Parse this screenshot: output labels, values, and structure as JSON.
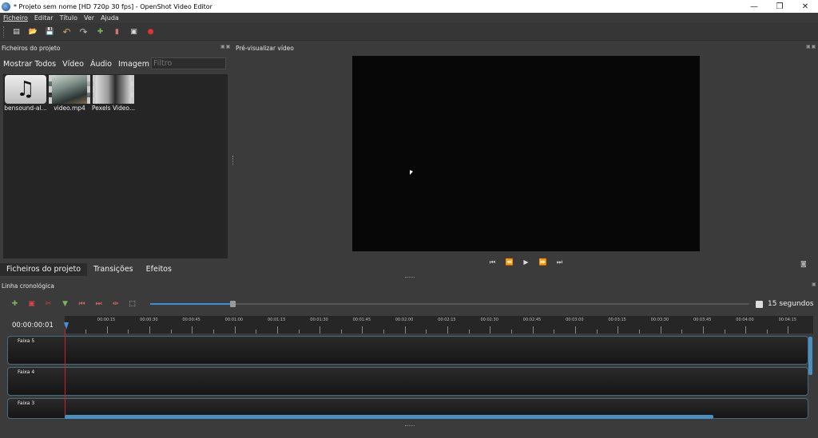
{
  "window": {
    "title": "* Projeto sem nome [HD 720p 30 fps] - OpenShot Video Editor",
    "minimize": "—",
    "maximize": "❐",
    "close": "✕"
  },
  "menu": [
    "Ficheiro",
    "Editar",
    "Título",
    "Ver",
    "Ajuda"
  ],
  "toolbar": {
    "icons": [
      "new-file-icon",
      "open-file-icon",
      "save-icon",
      "undo-icon",
      "redo-icon",
      "import-icon",
      "profile-icon",
      "fullscreen-icon",
      "record-icon"
    ],
    "glyphs": [
      "▤",
      "📂",
      "💾",
      "↶",
      "↷",
      "✚",
      "▮",
      "▣",
      "●"
    ]
  },
  "files_panel": {
    "header": "Ficheiros do projeto",
    "tabs": [
      "Mostrar Todos",
      "Vídeo",
      "Áudio",
      "Imagem"
    ],
    "filter_placeholder": "Filtro",
    "items": [
      {
        "label": "bensound-al...",
        "type": "audio"
      },
      {
        "label": "video.mp4",
        "type": "video"
      },
      {
        "label": "Pexels Video...",
        "type": "video"
      }
    ],
    "bottom_tabs": [
      "Ficheiros do projeto",
      "Transições",
      "Efeitos"
    ]
  },
  "preview_panel": {
    "header": "Pré-visualizar vídeo",
    "controls": [
      "⏮",
      "⏪",
      "▶",
      "⏩",
      "⏭"
    ]
  },
  "timeline": {
    "header": "Linha cronológica",
    "toolbar_glyphs": [
      "✚",
      "▣",
      "✂",
      "▼",
      "⏮",
      "⏭",
      "⇹",
      "⬚"
    ],
    "zoom_label": "15 segundos",
    "zoom_fraction": 0.15,
    "time_readout": "00:00:00:01",
    "ruler_labels": [
      "00:00:15",
      "00:00:30",
      "00:00:45",
      "00:01:00",
      "00:01:15",
      "00:01:30",
      "00:01:45",
      "00:02:00",
      "00:02:15",
      "00:02:30",
      "00:02:45",
      "00:03:00",
      "00:03:15",
      "00:03:30",
      "00:03:45",
      "00:04:00",
      "00:04:15"
    ],
    "tracks": [
      "Faixa 5",
      "Faixa 4",
      "Faixa 3"
    ]
  }
}
